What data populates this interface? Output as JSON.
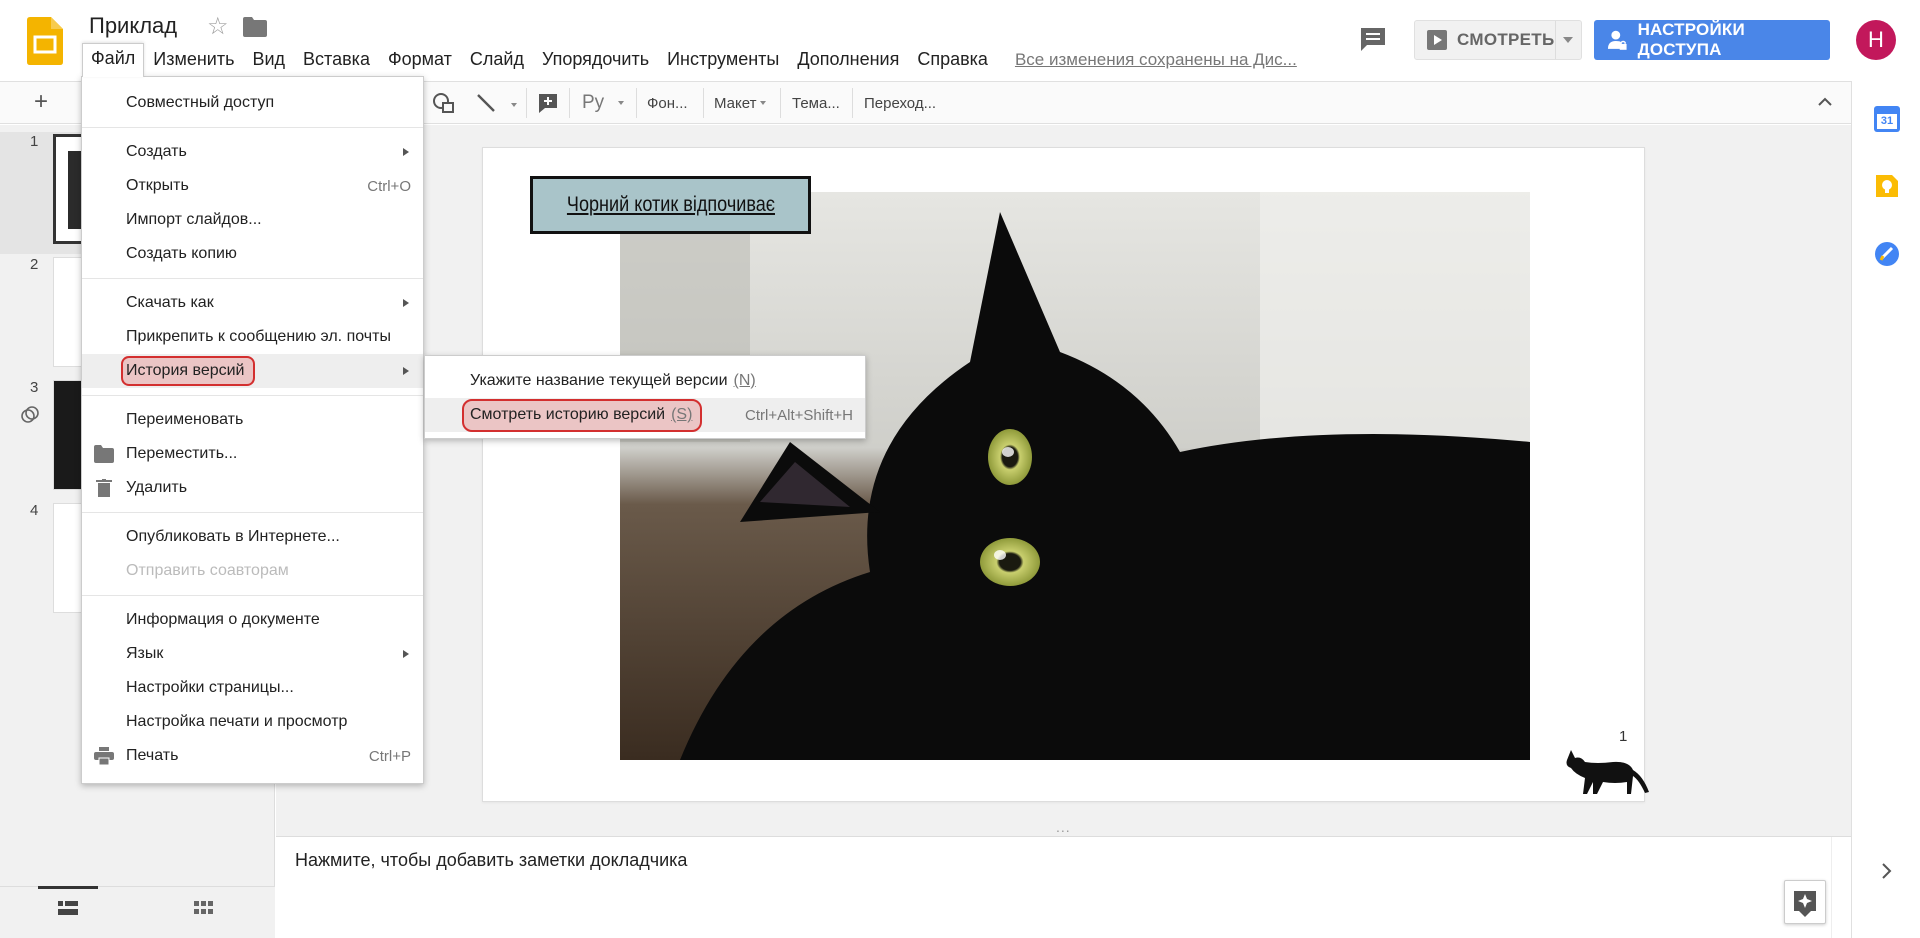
{
  "document": {
    "title": "Приклад",
    "save_status": "Все изменения сохранены на Дис..."
  },
  "menubar": {
    "items": [
      "Файл",
      "Изменить",
      "Вид",
      "Вставка",
      "Формат",
      "Слайд",
      "Упорядочить",
      "Инструменты",
      "Дополнения",
      "Справка"
    ],
    "active": "Файл"
  },
  "header_actions": {
    "present_label": "СМОТРЕТЬ",
    "share_label": "НАСТРОЙКИ ДОСТУПА",
    "avatar_initial": "Н",
    "share_color": "#4a86e8",
    "avatar_color": "#c2185b"
  },
  "toolbar": {
    "new_slide": "+",
    "font": "Ру",
    "background": "Фон...",
    "layout": "Макет",
    "theme": "Тема...",
    "transition": "Переход..."
  },
  "file_menu": {
    "share": "Совместный доступ",
    "create": "Создать",
    "open": "Открыть",
    "open_shortcut": "Ctrl+O",
    "import_slides": "Импорт слайдов...",
    "make_copy": "Создать копию",
    "download_as": "Скачать как",
    "email_attach": "Прикрепить к сообщению эл. почты",
    "version_history": "История версий",
    "rename": "Переименовать",
    "move": "Переместить...",
    "delete": "Удалить",
    "publish": "Опубликовать в Интернете...",
    "email_collaborators": "Отправить соавторам",
    "doc_details": "Информация о документе",
    "language": "Язык",
    "page_setup": "Настройки страницы...",
    "print_preview": "Настройка печати и просмотр",
    "print": "Печать",
    "print_shortcut": "Ctrl+P"
  },
  "version_submenu": {
    "name_version": "Укажите название текущей версии",
    "name_version_accel": "(N)",
    "see_history": "Смотреть историю версий",
    "see_history_accel": "(S)",
    "see_history_shortcut": "Ctrl+Alt+Shift+H"
  },
  "filmstrip": {
    "slide_numbers": [
      "1",
      "2",
      "3",
      "4"
    ],
    "selected": 1
  },
  "slide": {
    "title": "Чорний котик відпочиває",
    "page_number": "1",
    "title_box_color": "#a9c4c9"
  },
  "notes": {
    "placeholder": "Нажмите, чтобы добавить заметки докладчика"
  },
  "side_panel": {
    "calendar_day": "31"
  }
}
